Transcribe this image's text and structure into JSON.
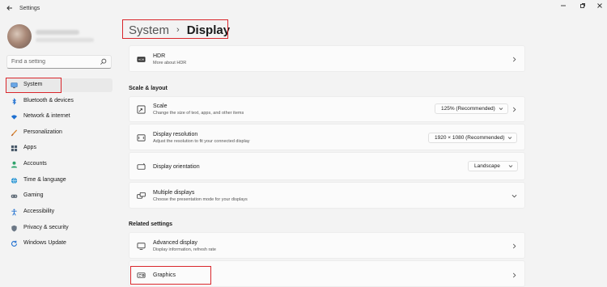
{
  "window": {
    "title": "Settings"
  },
  "search": {
    "placeholder": "Find a setting"
  },
  "sidebar": {
    "items": [
      {
        "label": "System",
        "icon": "monitor-icon",
        "selected": true
      },
      {
        "label": "Bluetooth & devices",
        "icon": "bluetooth-icon"
      },
      {
        "label": "Network & internet",
        "icon": "wifi-icon"
      },
      {
        "label": "Personalization",
        "icon": "brush-icon"
      },
      {
        "label": "Apps",
        "icon": "apps-icon"
      },
      {
        "label": "Accounts",
        "icon": "account-icon"
      },
      {
        "label": "Time & language",
        "icon": "globe-icon"
      },
      {
        "label": "Gaming",
        "icon": "gamepad-icon"
      },
      {
        "label": "Accessibility",
        "icon": "accessibility-icon"
      },
      {
        "label": "Privacy & security",
        "icon": "shield-icon"
      },
      {
        "label": "Windows Update",
        "icon": "update-icon"
      }
    ]
  },
  "breadcrumb": {
    "parent": "System",
    "separator": "›",
    "current": "Display"
  },
  "main": {
    "hdr": {
      "title": "HDR",
      "subtitle": "More about HDR",
      "icon": "hdr-icon"
    },
    "scale_layout": {
      "heading": "Scale & layout",
      "scale": {
        "title": "Scale",
        "subtitle": "Change the size of text, apps, and other items",
        "value": "125% (Recommended)",
        "icon": "scale-icon"
      },
      "resolution": {
        "title": "Display resolution",
        "subtitle": "Adjust the resolution to fit your connected display",
        "value": "1920 × 1080 (Recommended)",
        "icon": "resolution-icon"
      },
      "orientation": {
        "title": "Display orientation",
        "value": "Landscape",
        "icon": "orientation-icon"
      },
      "multiple": {
        "title": "Multiple displays",
        "subtitle": "Choose the presentation mode for your displays",
        "icon": "multiple-displays-icon"
      }
    },
    "related": {
      "heading": "Related settings",
      "advanced": {
        "title": "Advanced display",
        "subtitle": "Display information, refresh rate",
        "icon": "advanced-display-icon"
      },
      "graphics": {
        "title": "Graphics",
        "icon": "graphics-icon"
      }
    }
  },
  "colors": {
    "accent": "#0067c0",
    "highlight": "#d9262b",
    "background": "#f3f3f3",
    "card": "#fbfbfb"
  }
}
